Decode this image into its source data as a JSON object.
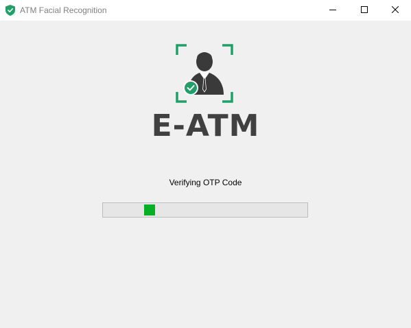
{
  "window": {
    "title": "ATM Facial Recognition",
    "app_icon": "shield-check-icon",
    "controls": {
      "minimize": "minimize-icon",
      "maximize": "maximize-icon",
      "close": "close-icon"
    }
  },
  "logo": {
    "icon": "face-scan-user-icon",
    "text": "E-ATM"
  },
  "status": {
    "message": "Verifying OTP Code"
  },
  "progress": {
    "mode": "marquee"
  },
  "colors": {
    "accent_green": "#1fa067",
    "progress_green": "#06b025",
    "logo_gray": "#404040",
    "background": "#f0f0f0"
  }
}
